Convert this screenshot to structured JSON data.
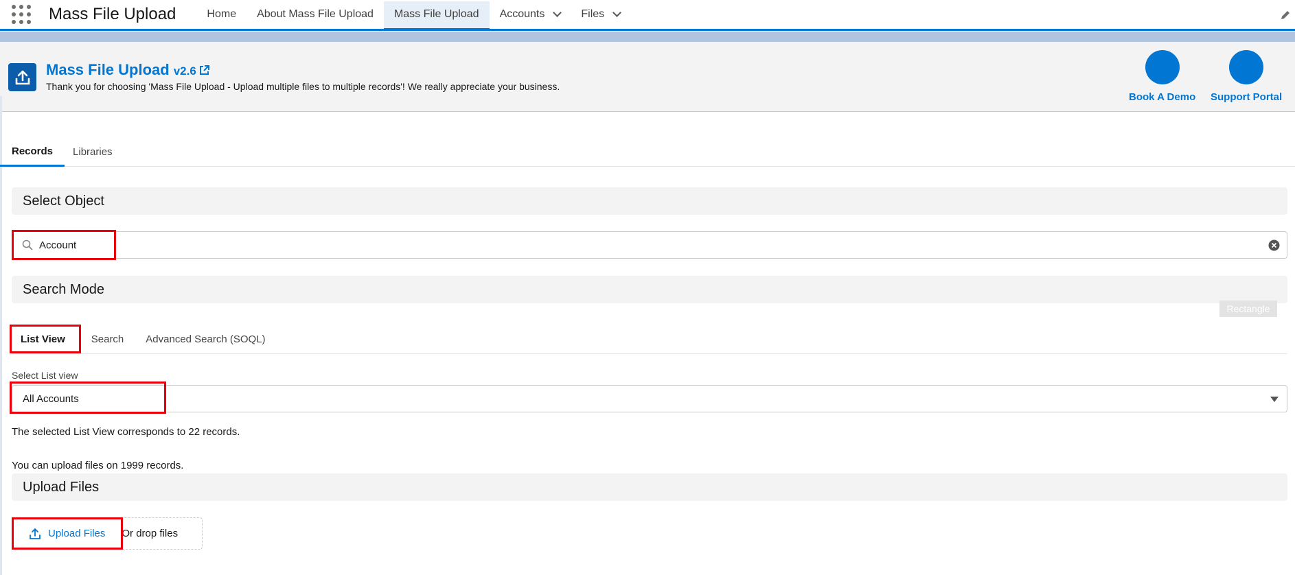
{
  "topnav": {
    "app_name": "Mass File Upload",
    "items": [
      {
        "label": "Home",
        "active": false,
        "dropdown": false
      },
      {
        "label": "About Mass File Upload",
        "active": false,
        "dropdown": false
      },
      {
        "label": "Mass File Upload",
        "active": true,
        "dropdown": false
      },
      {
        "label": "Accounts",
        "active": false,
        "dropdown": true
      },
      {
        "label": "Files",
        "active": false,
        "dropdown": true
      }
    ],
    "icons": {
      "launcher": "app-launcher-icon",
      "edit": "pencil-icon"
    }
  },
  "header": {
    "title": "Mass File Upload",
    "version": "v2.6",
    "subtitle": "Thank you for choosing 'Mass File Upload - Upload multiple files to multiple records'! We really appreciate your business.",
    "actions": [
      {
        "label": "Book A Demo"
      },
      {
        "label": "Support Portal"
      }
    ],
    "icon": "upload-icon"
  },
  "tabs": [
    {
      "label": "Records",
      "active": true
    },
    {
      "label": "Libraries",
      "active": false
    }
  ],
  "select_object": {
    "heading": "Select Object",
    "search_value": "Account"
  },
  "search_mode": {
    "heading": "Search Mode",
    "overlay_label": "Rectangle",
    "tabs": [
      {
        "label": "List View",
        "active": true
      },
      {
        "label": "Search",
        "active": false
      },
      {
        "label": "Advanced Search (SOQL)",
        "active": false
      }
    ]
  },
  "list_view": {
    "label": "Select List view",
    "selected": "All Accounts",
    "records_info": "The selected List View corresponds to 22 records.",
    "limit_info": "You can upload files on 1999 records."
  },
  "upload": {
    "heading": "Upload Files",
    "button_label": "Upload Files",
    "drop_text": "Or drop files"
  },
  "colors": {
    "brand": "#0176d3",
    "highlight": "#e8000b",
    "section_bg": "#f3f3f3"
  }
}
